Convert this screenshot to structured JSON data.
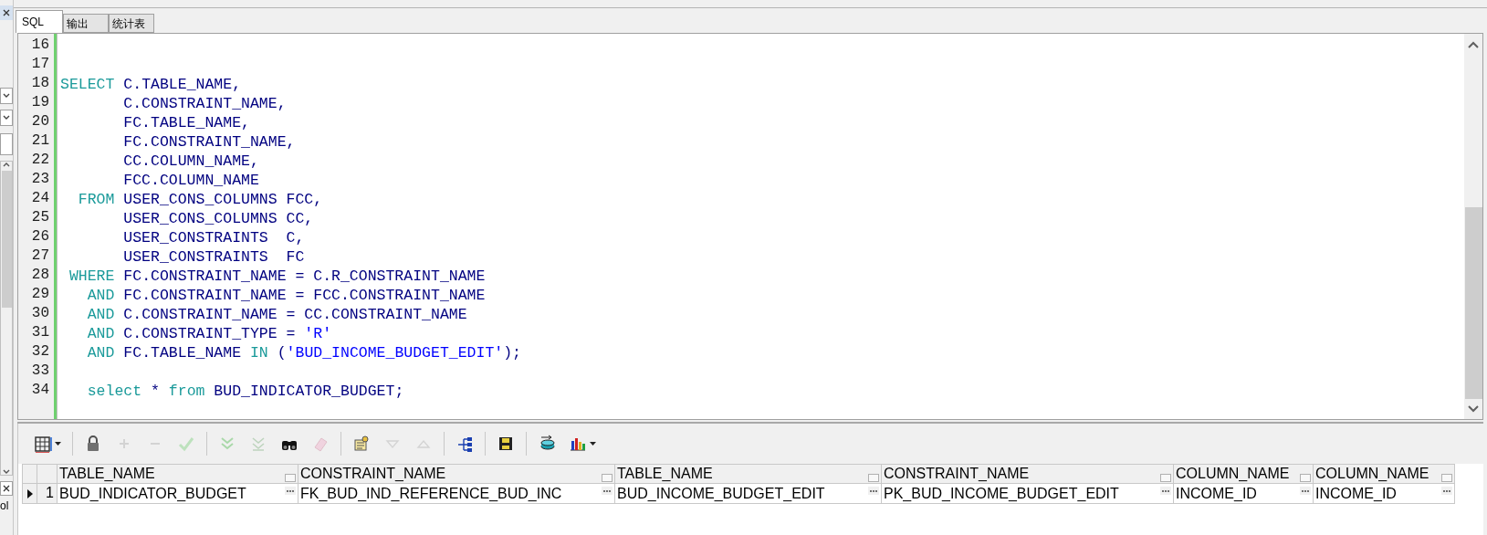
{
  "side_panel": {
    "text": "ol"
  },
  "tabs": [
    {
      "label": "SQL",
      "selected": true
    },
    {
      "label": "输出",
      "selected": false
    },
    {
      "label": "统计表",
      "selected": false
    }
  ],
  "editor": {
    "lines": [
      {
        "number": "16"
      },
      {
        "number": "17"
      },
      {
        "number": "18",
        "tokens": [
          {
            "kind": "keyword",
            "text": "SELECT"
          },
          {
            "kind": "ident",
            "text": " C.TABLE_NAME,"
          }
        ]
      },
      {
        "number": "19",
        "tokens": [
          {
            "kind": "ident",
            "text": "       C.CONSTRAINT_NAME,"
          }
        ]
      },
      {
        "number": "20",
        "tokens": [
          {
            "kind": "ident",
            "text": "       FC.TABLE_NAME,"
          }
        ]
      },
      {
        "number": "21",
        "tokens": [
          {
            "kind": "ident",
            "text": "       FC.CONSTRAINT_NAME,"
          }
        ]
      },
      {
        "number": "22",
        "tokens": [
          {
            "kind": "ident",
            "text": "       CC.COLUMN_NAME,"
          }
        ]
      },
      {
        "number": "23",
        "tokens": [
          {
            "kind": "ident",
            "text": "       FCC.COLUMN_NAME"
          }
        ]
      },
      {
        "number": "24",
        "tokens": [
          {
            "kind": "keyword",
            "text": "  FROM"
          },
          {
            "kind": "ident",
            "text": " USER_CONS_COLUMNS FCC,"
          }
        ]
      },
      {
        "number": "25",
        "tokens": [
          {
            "kind": "ident",
            "text": "       USER_CONS_COLUMNS CC,"
          }
        ]
      },
      {
        "number": "26",
        "tokens": [
          {
            "kind": "ident",
            "text": "       USER_CONSTRAINTS  C,"
          }
        ]
      },
      {
        "number": "27",
        "tokens": [
          {
            "kind": "ident",
            "text": "       USER_CONSTRAINTS  FC"
          }
        ]
      },
      {
        "number": "28",
        "tokens": [
          {
            "kind": "keyword",
            "text": " WHERE"
          },
          {
            "kind": "ident",
            "text": " FC.CONSTRAINT_NAME = C.R_CONSTRAINT_NAME"
          }
        ]
      },
      {
        "number": "29",
        "tokens": [
          {
            "kind": "keyword",
            "text": "   AND"
          },
          {
            "kind": "ident",
            "text": " FC.CONSTRAINT_NAME = FCC.CONSTRAINT_NAME"
          }
        ]
      },
      {
        "number": "30",
        "tokens": [
          {
            "kind": "keyword",
            "text": "   AND"
          },
          {
            "kind": "ident",
            "text": " C.CONSTRAINT_NAME = CC.CONSTRAINT_NAME"
          }
        ]
      },
      {
        "number": "31",
        "tokens": [
          {
            "kind": "keyword",
            "text": "   AND"
          },
          {
            "kind": "ident",
            "text": " C.CONSTRAINT_TYPE = "
          },
          {
            "kind": "string",
            "text": "'R'"
          }
        ]
      },
      {
        "number": "32",
        "tokens": [
          {
            "kind": "keyword",
            "text": "   AND"
          },
          {
            "kind": "ident",
            "text": " FC.TABLE_NAME "
          },
          {
            "kind": "keyword",
            "text": "IN"
          },
          {
            "kind": "ident",
            "text": " ("
          },
          {
            "kind": "string",
            "text": "'BUD_INCOME_BUDGET_EDIT'"
          },
          {
            "kind": "ident",
            "text": ");"
          }
        ]
      },
      {
        "number": "33"
      },
      {
        "number": "34",
        "tokens": [
          {
            "kind": "keyword",
            "text": "   select"
          },
          {
            "kind": "ident",
            "text": " * "
          },
          {
            "kind": "keyword",
            "text": "from"
          },
          {
            "kind": "ident",
            "text": " BUD_INDICATOR_BUDGET;"
          }
        ]
      }
    ]
  },
  "toolbar": [
    {
      "kind": "grid",
      "disabled": false
    },
    {
      "kind": "separator"
    },
    {
      "kind": "lock",
      "disabled": false
    },
    {
      "kind": "plus",
      "disabled": true
    },
    {
      "kind": "minus",
      "disabled": true
    },
    {
      "kind": "check",
      "disabled": true
    },
    {
      "kind": "separator"
    },
    {
      "kind": "down-double",
      "disabled": true
    },
    {
      "kind": "down-line",
      "disabled": true
    },
    {
      "kind": "binoculars",
      "disabled": false
    },
    {
      "kind": "eraser",
      "disabled": true
    },
    {
      "kind": "separator"
    },
    {
      "kind": "query",
      "disabled": false
    },
    {
      "kind": "triangle-down",
      "disabled": true
    },
    {
      "kind": "triangle-up",
      "disabled": true
    },
    {
      "kind": "separator"
    },
    {
      "kind": "tree",
      "disabled": false
    },
    {
      "kind": "separator"
    },
    {
      "kind": "save",
      "disabled": false
    },
    {
      "kind": "separator"
    },
    {
      "kind": "export",
      "disabled": false
    },
    {
      "kind": "chart",
      "disabled": false
    }
  ],
  "grid": {
    "columns": [
      "TABLE_NAME",
      "CONSTRAINT_NAME",
      "TABLE_NAME",
      "CONSTRAINT_NAME",
      "COLUMN_NAME",
      "COLUMN_NAME"
    ],
    "rows": [
      {
        "number": "1",
        "current": true,
        "cells": [
          "BUD_INDICATOR_BUDGET",
          "FK_BUD_IND_REFERENCE_BUD_INC",
          "BUD_INCOME_BUDGET_EDIT",
          "PK_BUD_INCOME_BUDGET_EDIT",
          "INCOME_ID",
          "INCOME_ID"
        ]
      }
    ]
  }
}
